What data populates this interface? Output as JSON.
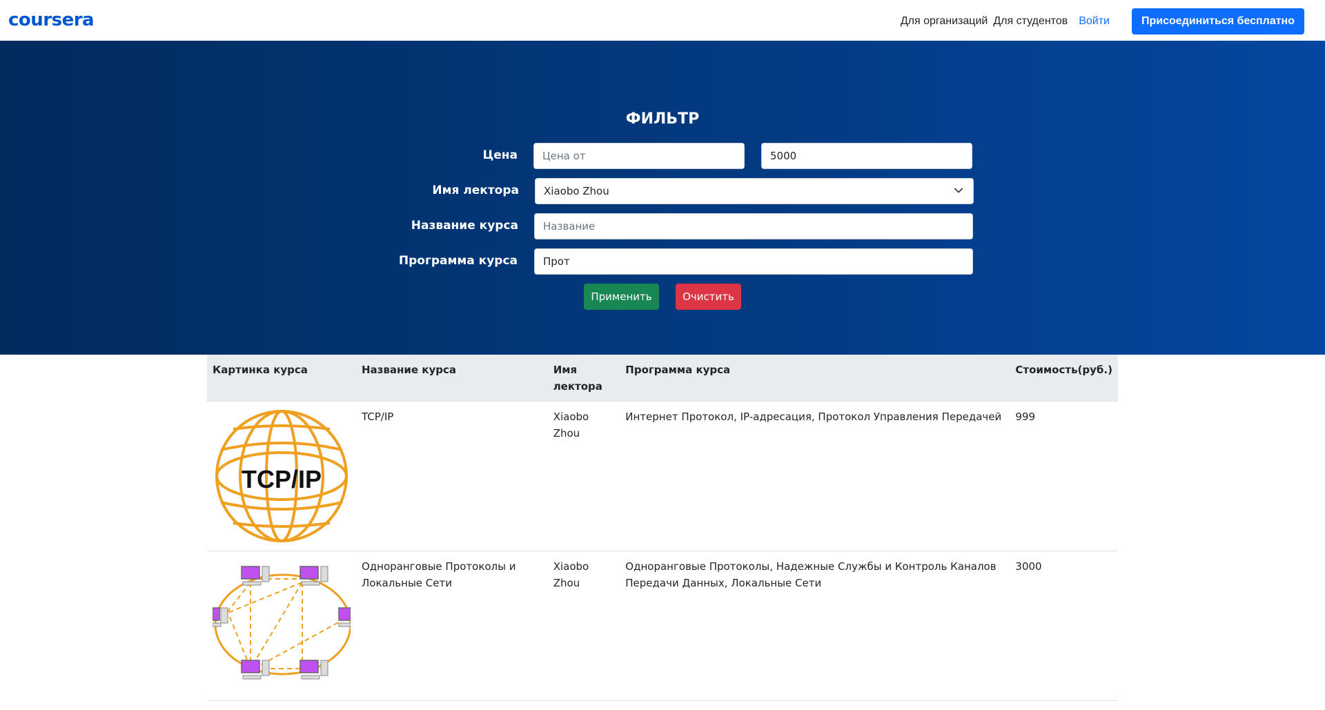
{
  "navbar": {
    "logo": "coursera",
    "links": [
      "Для организаций",
      "Для студентов"
    ],
    "login": "Войти",
    "join": "Присоединиться бесплатно"
  },
  "filter": {
    "title": "ФИЛЬТР",
    "price_label": "Цена",
    "price_from_placeholder": "Цена от",
    "price_from_value": "",
    "price_to_value": "5000",
    "lecturer_label": "Имя лектора",
    "lecturer_selected": "Xiaobo Zhou",
    "course_name_label": "Название курса",
    "course_name_placeholder": "Название",
    "course_name_value": "",
    "program_label": "Программа курса",
    "program_value": "Прот",
    "apply": "Применить",
    "clear": "Очистить"
  },
  "table": {
    "headers": [
      "Картинка курса",
      "Название курса",
      "Имя лектора",
      "Программа курса",
      "Стоимость(руб.)"
    ],
    "rows": [
      {
        "image_text": "TCP/IP",
        "name": "TCP/IP",
        "lecturer": "Xiaobo Zhou",
        "program": "Интернет Протокол, IP-адресация, Протокол Управления Передачей",
        "price": "999"
      },
      {
        "image_text": "",
        "name": "Одноранговые Протоколы и Локальные Сети",
        "lecturer": "Xiaobo Zhou",
        "program": "Одноранговые Протоколы, Надежные Службы и Контроль Каналов Передачи Данных, Локальные Сети",
        "price": "3000"
      }
    ]
  },
  "colors": {
    "brand": "#0056d2",
    "primary": "#0d6efd",
    "success": "#198754",
    "danger": "#dc3545",
    "hero_dark": "#022b5e",
    "hero_light": "#0347a0",
    "globe": "#f0a020",
    "pc_screen": "#c050f0"
  },
  "icons": {
    "select_chevron": "chevron-down-icon",
    "course_image_1": "tcp-ip-globe-image",
    "course_image_2": "p2p-network-image"
  }
}
